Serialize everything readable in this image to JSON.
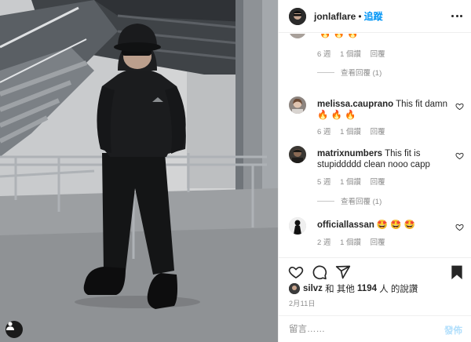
{
  "header": {
    "username": "jonlaflare",
    "separator": "•",
    "follow_label": "追蹤"
  },
  "comments": [
    {
      "username": "",
      "text": "🔥 🔥 🔥",
      "time": "6 週",
      "likes": "1 個讚",
      "reply": "回覆",
      "view_replies": "查看回覆 (1)"
    },
    {
      "username": "melissa.cauprano",
      "text": "This fit damn 🔥 🔥 🔥",
      "time": "6 週",
      "likes": "1 個讚",
      "reply": "回覆"
    },
    {
      "username": "matrixnumbers",
      "text": "This fit is stupiddddd clean nooo capp",
      "time": "5 週",
      "likes": "1 個讚",
      "reply": "回覆",
      "view_replies": "查看回覆 (1)"
    },
    {
      "username": "officiallassan",
      "text": "🤩 🤩 🤩",
      "time": "2 週",
      "likes": "1 個讚",
      "reply": "回覆"
    }
  ],
  "likes": {
    "liked_by": "silvz",
    "connector": "和 其他",
    "count": "1194",
    "suffix": "人 的說讚"
  },
  "date": "2月11日",
  "comment_box": {
    "placeholder": "留言……",
    "post_label": "發佈"
  },
  "icons": {
    "header_more": "more-horizontal-icon",
    "like": "heart-icon",
    "comment": "comment-icon",
    "share": "paper-plane-icon",
    "save": "bookmark-icon",
    "tag": "user-tag-icon"
  },
  "colors": {
    "accent": "#0095f6",
    "post_disabled": "#b2dffc",
    "muted_text": "#8e8e8e",
    "primary_text": "#262626",
    "divider": "#efefef"
  }
}
